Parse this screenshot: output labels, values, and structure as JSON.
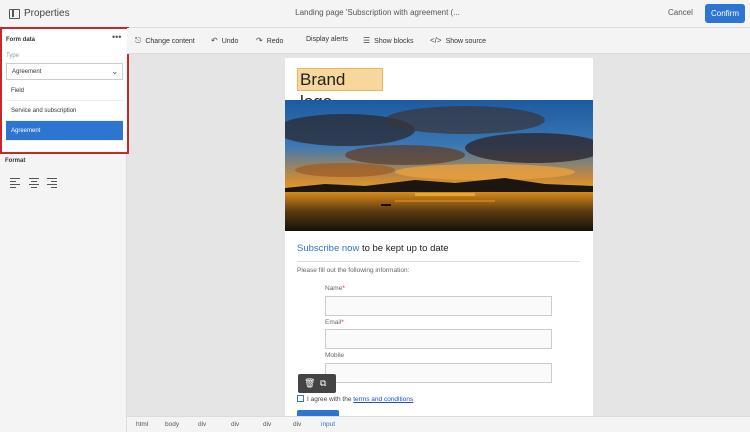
{
  "topbar": {
    "properties_label": "Properties",
    "page_title": "Landing page 'Subscription with agreement (...",
    "cancel_label": "Cancel",
    "confirm_label": "Confirm",
    "accent_color": "#2d75d0"
  },
  "left_panel": {
    "form_data_title": "Form data",
    "more_label": "•••",
    "type_label": "Type",
    "type_selected": "Agreement",
    "type_options": [
      "Field",
      "Service and subscription",
      "Agreement"
    ],
    "format_title": "Format",
    "highlight_color": "#c6292b"
  },
  "toolbar": {
    "change_content": "Change content",
    "undo": "Undo",
    "redo": "Redo",
    "display_alerts": "Display alerts",
    "show_blocks": "Show blocks",
    "show_source": "Show source"
  },
  "document": {
    "brand_logo": "Brand logo",
    "subscribe_link": "Subscribe now",
    "subscribe_rest": " to be kept up to date",
    "fill_out": "Please fill out the following information:",
    "fields": [
      {
        "label": "Name",
        "required": "*"
      },
      {
        "label": "Email",
        "required": "*"
      },
      {
        "label": "Mobile",
        "required": ""
      }
    ],
    "agree_prefix": "I agree with the ",
    "agree_link": "terms and conditions"
  },
  "breadcrumb": [
    "html",
    "body",
    "div",
    "div",
    "div",
    "div",
    "input"
  ]
}
